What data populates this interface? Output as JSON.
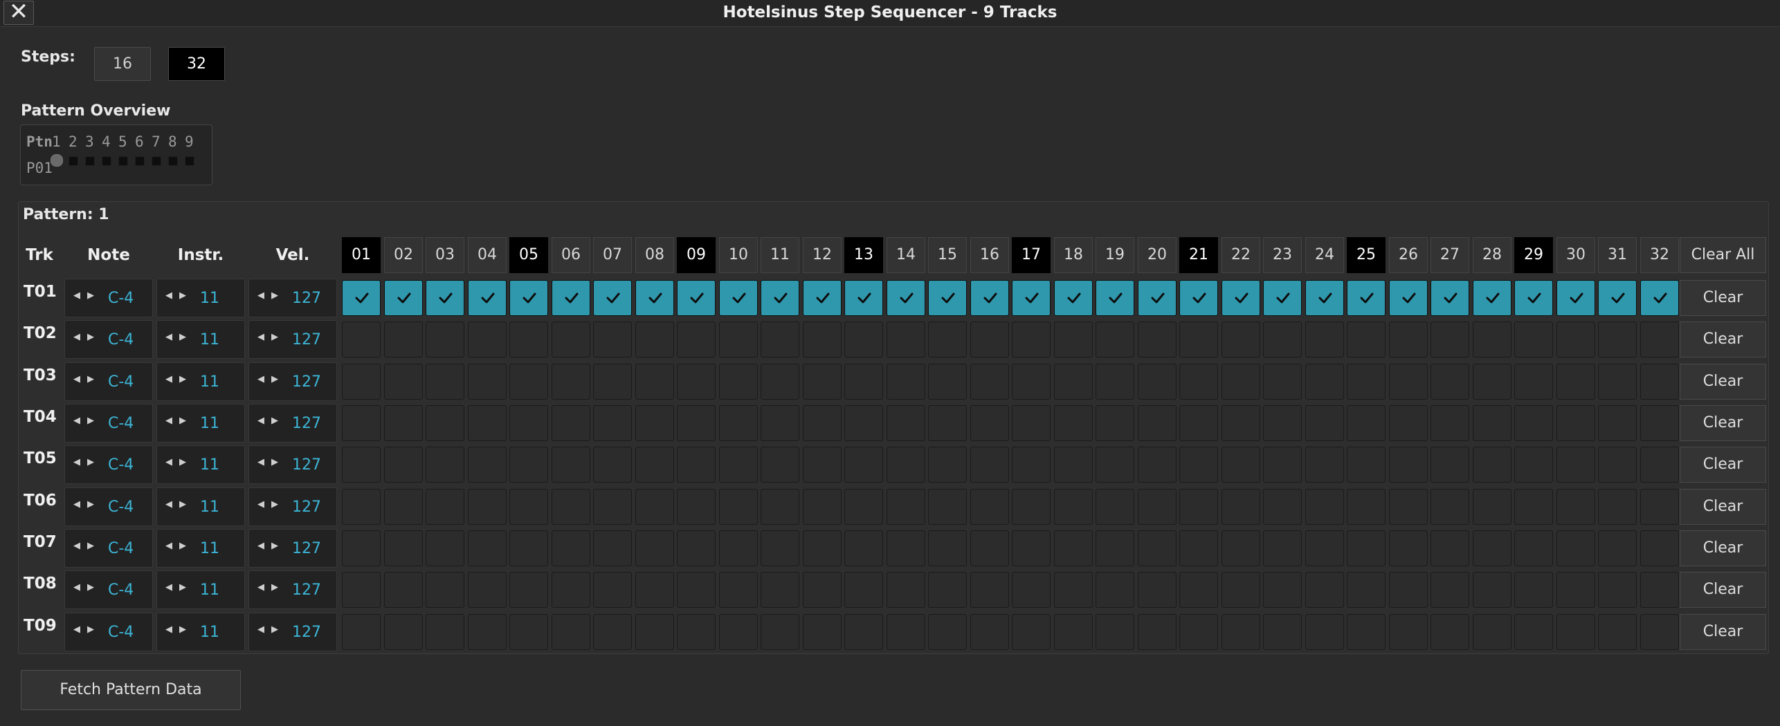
{
  "window": {
    "title": "Hotelsinus Step Sequencer - 9 Tracks",
    "close_label": "✕"
  },
  "steps": {
    "label": "Steps:",
    "options": [
      "16",
      "32"
    ],
    "selected": "32"
  },
  "overview": {
    "label": "Pattern Overview",
    "header": "Ptn",
    "columns": [
      "1",
      "2",
      "3",
      "4",
      "5",
      "6",
      "7",
      "8",
      "9"
    ],
    "row_label": "P01",
    "current_column": 1
  },
  "pattern": {
    "label": "Pattern: 1",
    "headers": {
      "trk": "Trk",
      "note": "Note",
      "instr": "Instr.",
      "vel": "Vel."
    },
    "clear_all_label": "Clear All",
    "clear_label": "Clear",
    "step_labels": [
      "01",
      "02",
      "03",
      "04",
      "05",
      "06",
      "07",
      "08",
      "09",
      "10",
      "11",
      "12",
      "13",
      "14",
      "15",
      "16",
      "17",
      "18",
      "19",
      "20",
      "21",
      "22",
      "23",
      "24",
      "25",
      "26",
      "27",
      "28",
      "29",
      "30",
      "31",
      "32"
    ],
    "beat_steps": [
      1,
      5,
      9,
      13,
      17,
      21,
      25,
      29
    ],
    "tracks": [
      {
        "name": "T01",
        "note": "C-4",
        "instr": "11",
        "vel": "127",
        "active_steps": [
          1,
          2,
          3,
          4,
          5,
          6,
          7,
          8,
          9,
          10,
          11,
          12,
          13,
          14,
          15,
          16,
          17,
          18,
          19,
          20,
          21,
          22,
          23,
          24,
          25,
          26,
          27,
          28,
          29,
          30,
          31,
          32
        ]
      },
      {
        "name": "T02",
        "note": "C-4",
        "instr": "11",
        "vel": "127",
        "active_steps": []
      },
      {
        "name": "T03",
        "note": "C-4",
        "instr": "11",
        "vel": "127",
        "active_steps": []
      },
      {
        "name": "T04",
        "note": "C-4",
        "instr": "11",
        "vel": "127",
        "active_steps": []
      },
      {
        "name": "T05",
        "note": "C-4",
        "instr": "11",
        "vel": "127",
        "active_steps": []
      },
      {
        "name": "T06",
        "note": "C-4",
        "instr": "11",
        "vel": "127",
        "active_steps": []
      },
      {
        "name": "T07",
        "note": "C-4",
        "instr": "11",
        "vel": "127",
        "active_steps": []
      },
      {
        "name": "T08",
        "note": "C-4",
        "instr": "11",
        "vel": "127",
        "active_steps": []
      },
      {
        "name": "T09",
        "note": "C-4",
        "instr": "11",
        "vel": "127",
        "active_steps": []
      }
    ]
  },
  "fetch_label": "Fetch Pattern Data",
  "colors": {
    "accent": "#3cb5d6",
    "step_on": "#2f98ad",
    "beat_header": "#000000"
  },
  "icons": {
    "close": "close-icon",
    "step_on": "check-icon",
    "arrows": "left-right-arrows-icon"
  }
}
